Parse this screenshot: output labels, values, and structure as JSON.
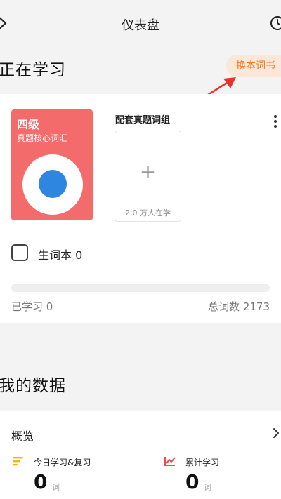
{
  "header": {
    "title": "仪表盘"
  },
  "learning": {
    "section_title": "正在学习",
    "switch_book_label": "换本词书",
    "book": {
      "level": "四级",
      "subtitle": "真题核心词汇"
    },
    "word_group": {
      "title": "配套真题词组",
      "plus": "+",
      "count_text": "2.0 万人在学"
    },
    "new_words_label": "生词本 0",
    "progress_fraction": 0,
    "learned_text": "已学习 0",
    "total_text": "总词数 2173"
  },
  "my_data": {
    "section_title": "我的数据",
    "overview_title": "概览",
    "today": {
      "label": "今日学习&复习",
      "value": "0",
      "unit": "词",
      "icon": "bars-icon",
      "color": "#f5b21b"
    },
    "cumulative": {
      "label": "累计学习",
      "value": "0",
      "unit": "词",
      "icon": "line-chart-icon",
      "color": "#ee4b4b"
    }
  },
  "colors": {
    "accent_orange": "#f07a24",
    "book_red": "#f46b6b",
    "book_blue": "#2f86e0",
    "arrow_red": "#e8332c"
  }
}
